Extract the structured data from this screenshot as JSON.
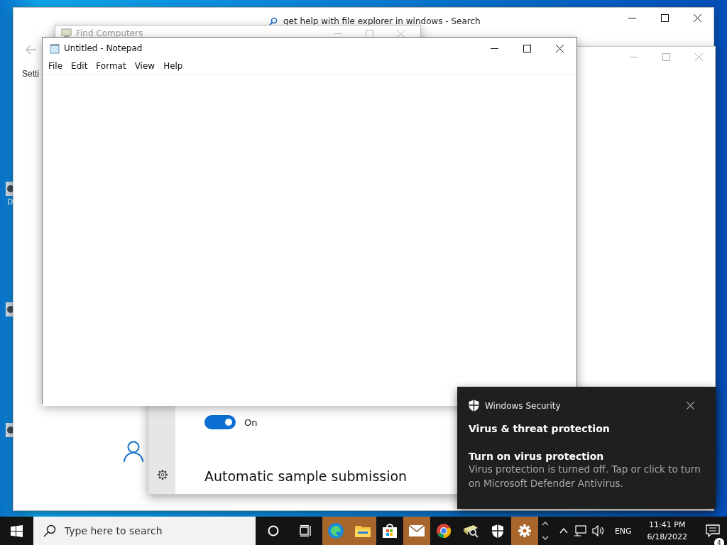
{
  "desktop": {
    "icon_label": "D"
  },
  "browser_window": {
    "title": "get help with file explorer in windows - Search",
    "page_text": "Setti"
  },
  "settings_window": {
    "toggle": {
      "on": true,
      "label": "On"
    },
    "heading": "Automatic sample submission"
  },
  "find_computers_window": {
    "title": "Find Computers"
  },
  "notepad": {
    "title": "Untitled - Notepad",
    "menu": [
      "File",
      "Edit",
      "Format",
      "View",
      "Help"
    ]
  },
  "toast": {
    "app": "Windows Security",
    "title": "Virus & threat protection",
    "subtitle": "Turn on virus protection",
    "body": "Virus protection is turned off. Tap or click to turn on Microsoft Defender Antivirus."
  },
  "taskbar": {
    "search_placeholder": "Type here to search",
    "apps": [
      {
        "kind": "edge",
        "highlighted": true
      },
      {
        "kind": "folder",
        "highlighted": true
      },
      {
        "kind": "store",
        "highlighted": false
      },
      {
        "kind": "mail",
        "highlighted": true
      },
      {
        "kind": "chrome",
        "highlighted": false
      },
      {
        "kind": "scanner",
        "highlighted": false
      },
      {
        "kind": "shield",
        "highlighted": false
      },
      {
        "kind": "gear",
        "highlighted": true
      }
    ],
    "language": "ENG",
    "time": "11:41 PM",
    "date": "6/18/2022",
    "notification_count": "4"
  }
}
